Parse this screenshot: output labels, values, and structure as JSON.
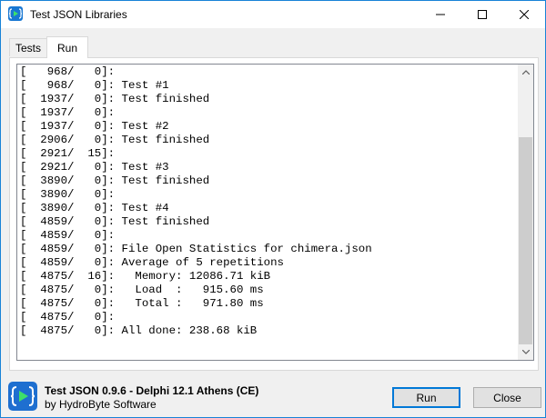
{
  "window": {
    "title": "Test JSON Libraries",
    "controls": {
      "minimize_icon": "minimize-icon",
      "maximize_icon": "maximize-icon",
      "close_icon": "close-icon"
    }
  },
  "tabs": [
    {
      "label": "Tests",
      "active": false
    },
    {
      "label": "Run",
      "active": true
    }
  ],
  "log": {
    "lines": [
      "[   968/   0]:",
      "[   968/   0]: Test #1",
      "[  1937/   0]: Test finished",
      "[  1937/   0]:",
      "[  1937/   0]: Test #2",
      "[  2906/   0]: Test finished",
      "[  2921/  15]:",
      "[  2921/   0]: Test #3",
      "[  3890/   0]: Test finished",
      "[  3890/   0]:",
      "[  3890/   0]: Test #4",
      "[  4859/   0]: Test finished",
      "[  4859/   0]:",
      "[  4859/   0]: File Open Statistics for chimera.json",
      "[  4859/   0]: Average of 5 repetitions",
      "[  4875/  16]:   Memory: 12086.71 kiB",
      "[  4875/   0]:   Load  :   915.60 ms",
      "[  4875/   0]:   Total :   971.80 ms",
      "[  4875/   0]:",
      "[  4875/   0]: All done: 238.68 kiB"
    ]
  },
  "footer": {
    "product": "Test JSON 0.9.6 - Delphi 12.1 Athens (CE)",
    "company": "by HydroByte Software",
    "run_label": "Run",
    "close_label": "Close"
  },
  "colors": {
    "accent": "#0078d7",
    "logo": "#1e6fd0"
  }
}
